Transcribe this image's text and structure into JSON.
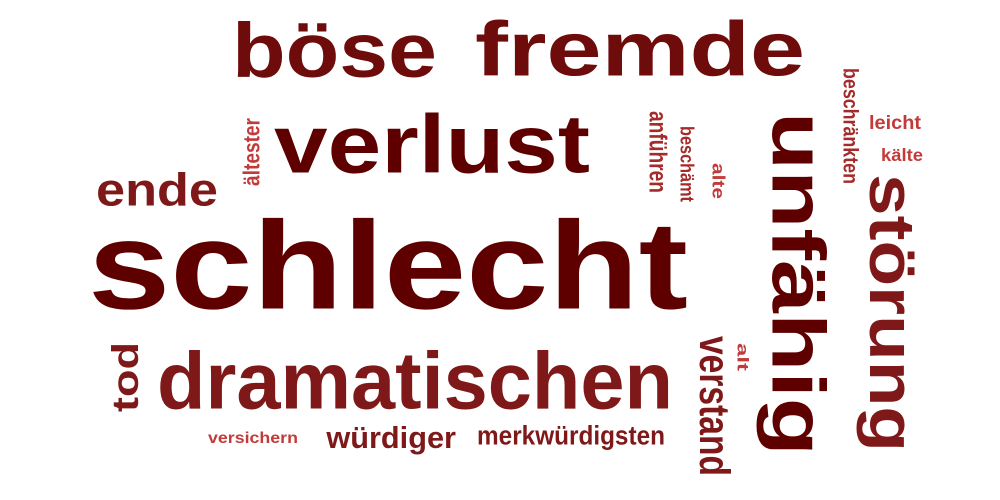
{
  "word_cloud": {
    "palette": {
      "darkest": "#5e0000",
      "dark": "#6e0b0b",
      "mid": "#7f1818",
      "light": "#a52a2a",
      "lightest": "#c23b3b"
    },
    "words": [
      {
        "text": "schlecht",
        "tone": "darkest"
      },
      {
        "text": "verlust",
        "tone": "darkest"
      },
      {
        "text": "fremde",
        "tone": "dark"
      },
      {
        "text": "böse",
        "tone": "dark"
      },
      {
        "text": "unfähig",
        "tone": "darkest"
      },
      {
        "text": "dramatischen",
        "tone": "mid"
      },
      {
        "text": "störung",
        "tone": "mid"
      },
      {
        "text": "ende",
        "tone": "mid"
      },
      {
        "text": "verstand",
        "tone": "mid"
      },
      {
        "text": "tod",
        "tone": "mid"
      },
      {
        "text": "würdiger",
        "tone": "mid"
      },
      {
        "text": "merkwürdigsten",
        "tone": "mid"
      },
      {
        "text": "versichern",
        "tone": "lightest"
      },
      {
        "text": "leicht",
        "tone": "lightest"
      },
      {
        "text": "kälte",
        "tone": "lightest"
      },
      {
        "text": "beschränkten",
        "tone": "light"
      },
      {
        "text": "anführen",
        "tone": "light"
      },
      {
        "text": "beschämt",
        "tone": "light"
      },
      {
        "text": "alte",
        "tone": "lightest"
      },
      {
        "text": "ältester",
        "tone": "lightest"
      },
      {
        "text": "alt",
        "tone": "lightest"
      }
    ]
  }
}
